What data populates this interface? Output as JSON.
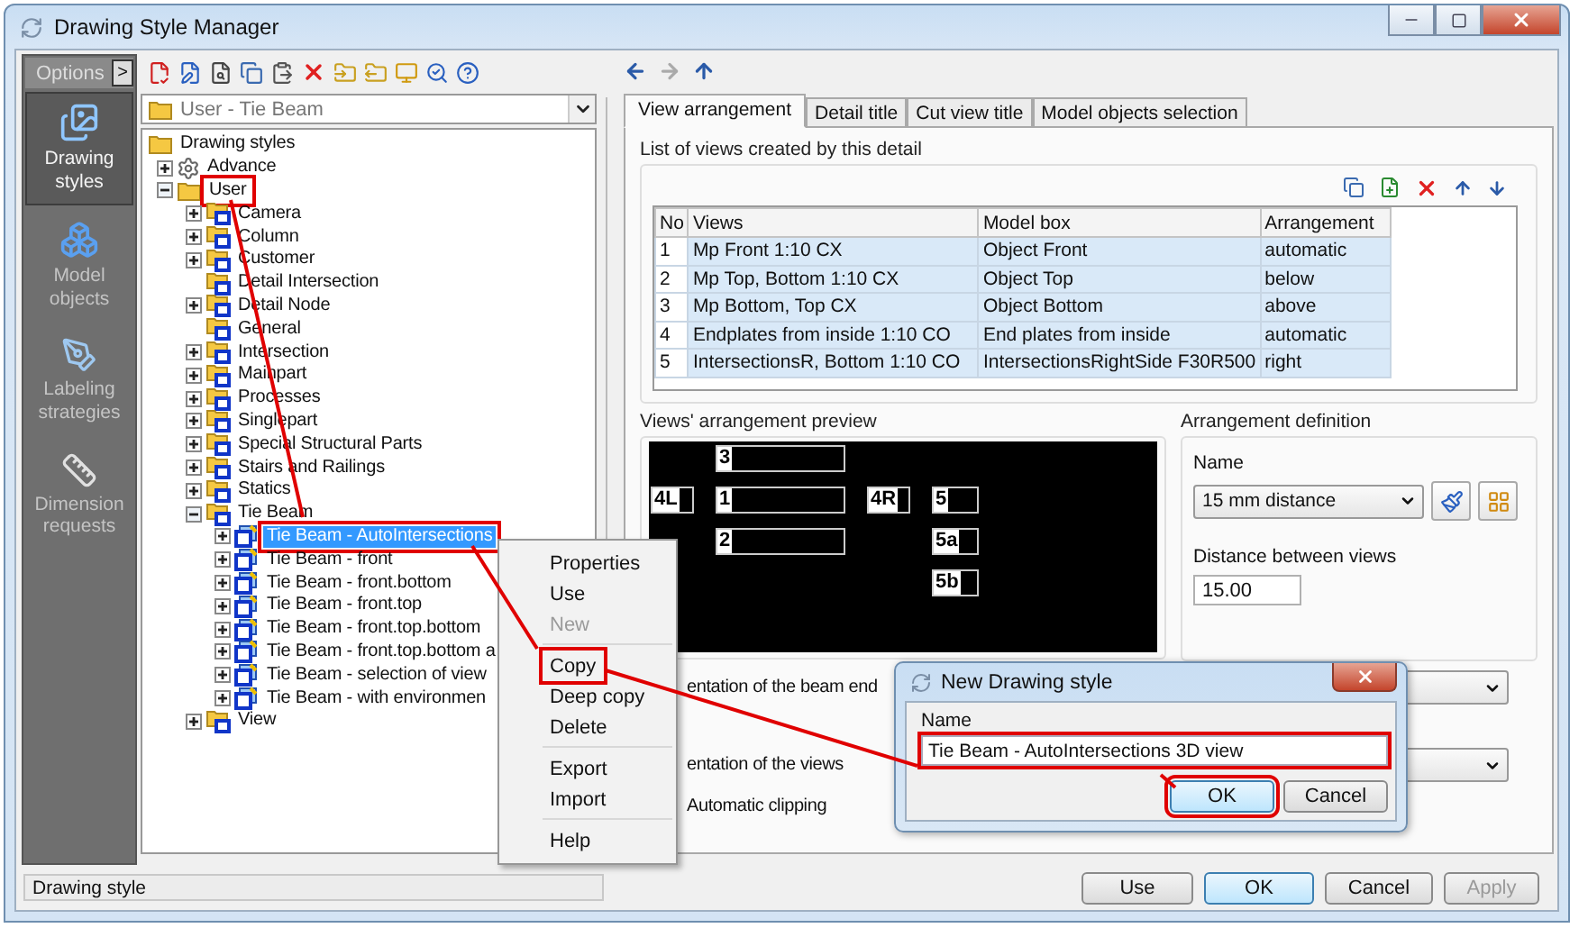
{
  "window": {
    "title": "Drawing Style Manager"
  },
  "sidebar": {
    "header": "Options",
    "expand_button": ">",
    "items": [
      {
        "label": "Drawing styles",
        "selected": true,
        "kind": "styles"
      },
      {
        "label": "Model objects",
        "selected": false,
        "kind": "objects"
      },
      {
        "label": "Labeling strategies",
        "selected": false,
        "kind": "labeling"
      },
      {
        "label": "Dimension requests",
        "selected": false,
        "kind": "dimension"
      }
    ]
  },
  "style_selector": {
    "value": "User - Tie Beam"
  },
  "tree": [
    {
      "label": "Drawing styles",
      "kind": "folder",
      "selected": false,
      "annotated": false,
      "children": [
        {
          "label": "Advance",
          "kind": "gear",
          "expanded": false,
          "selected": false,
          "annotated": false
        },
        {
          "label": "User",
          "kind": "folder",
          "expanded": true,
          "selected": false,
          "annotated": true,
          "children": [
            {
              "label": "Camera",
              "kind": "stylefolder",
              "expanded": false,
              "selected": false,
              "annotated": false
            },
            {
              "label": "Column",
              "kind": "stylefolder",
              "expanded": false,
              "selected": false,
              "annotated": false
            },
            {
              "label": "Customer",
              "kind": "stylefolder",
              "expanded": false,
              "selected": false,
              "annotated": false
            },
            {
              "label": "Detail Intersection",
              "kind": "stylefolder",
              "selected": false,
              "annotated": false
            },
            {
              "label": "Detail Node",
              "kind": "stylefolder",
              "expanded": false,
              "selected": false,
              "annotated": false
            },
            {
              "label": "General",
              "kind": "stylefolder",
              "selected": false,
              "annotated": false
            },
            {
              "label": "Intersection",
              "kind": "stylefolder",
              "expanded": false,
              "selected": false,
              "annotated": false
            },
            {
              "label": "Mainpart",
              "kind": "stylefolder",
              "expanded": false,
              "selected": false,
              "annotated": false
            },
            {
              "label": "Processes",
              "kind": "stylefolder",
              "expanded": false,
              "selected": false,
              "annotated": false
            },
            {
              "label": "Singlepart",
              "kind": "stylefolder",
              "expanded": false,
              "selected": false,
              "annotated": false
            },
            {
              "label": "Special Structural Parts",
              "kind": "stylefolder",
              "expanded": false,
              "selected": false,
              "annotated": false
            },
            {
              "label": "Stairs and Railings",
              "kind": "stylefolder",
              "expanded": false,
              "selected": false,
              "annotated": false
            },
            {
              "label": "Statics",
              "kind": "stylefolder",
              "expanded": false,
              "selected": false,
              "annotated": false
            },
            {
              "label": "Tie Beam",
              "kind": "stylefolder",
              "expanded": true,
              "selected": false,
              "annotated": false,
              "children": [
                {
                  "label": "Tie Beam - AutoIntersections",
                  "kind": "style",
                  "expanded": false,
                  "selected": true,
                  "annotated": true
                },
                {
                  "label": "Tie Beam - front",
                  "kind": "style",
                  "expanded": false,
                  "selected": false,
                  "annotated": false
                },
                {
                  "label": "Tie Beam - front.bottom",
                  "kind": "style",
                  "expanded": false,
                  "selected": false,
                  "annotated": false
                },
                {
                  "label": "Tie Beam - front.top",
                  "kind": "style",
                  "expanded": false,
                  "selected": false,
                  "annotated": false
                },
                {
                  "label": "Tie Beam - front.top.bottom",
                  "kind": "style",
                  "expanded": false,
                  "selected": false,
                  "annotated": false
                },
                {
                  "label": "Tie Beam - front.top.bottom a",
                  "kind": "style",
                  "expanded": false,
                  "selected": false,
                  "annotated": false
                },
                {
                  "label": "Tie Beam - selection of view",
                  "kind": "style",
                  "expanded": false,
                  "selected": false,
                  "annotated": false
                },
                {
                  "label": "Tie Beam - with environmen",
                  "kind": "style",
                  "expanded": false,
                  "selected": false,
                  "annotated": false
                }
              ]
            },
            {
              "label": "View",
              "kind": "stylefolder",
              "expanded": false,
              "selected": false,
              "annotated": false
            }
          ]
        }
      ]
    }
  ],
  "tabs": [
    {
      "label": "View arrangement",
      "selected": true
    },
    {
      "label": "Detail title",
      "selected": false
    },
    {
      "label": "Cut view title",
      "selected": false
    },
    {
      "label": "Model objects selection",
      "selected": false
    }
  ],
  "views_list": {
    "title": "List of views created by this detail",
    "columns": [
      "No",
      "Views",
      "Model box",
      "Arrangement"
    ],
    "rows": [
      [
        "1",
        "Mp Front 1:10 CX",
        "Object Front",
        "automatic"
      ],
      [
        "2",
        "Mp Top, Bottom 1:10 CX",
        "Object Top",
        "below"
      ],
      [
        "3",
        "Mp Bottom, Top CX",
        "Object Bottom",
        "above"
      ],
      [
        "4",
        "Endplates from inside 1:10 CO",
        "End plates from inside",
        "automatic"
      ],
      [
        "5",
        "IntersectionsR, Bottom 1:10 CO",
        "IntersectionsRightSide F30R500",
        "right"
      ]
    ]
  },
  "preview": {
    "title": "Views' arrangement preview",
    "left": [
      "4L"
    ],
    "main": [
      "3",
      "1",
      "2"
    ],
    "right": [
      "4R"
    ],
    "side": [
      "5",
      "5a",
      "5b"
    ]
  },
  "arrangement": {
    "title": "Arrangement definition",
    "name_label": "Name",
    "name_value": "15 mm distance",
    "distance_label": "Distance between views",
    "distance_value": "15.00"
  },
  "options": [
    {
      "label": "entation of the beam end",
      "kind": "dropdown"
    },
    {
      "label": "entation of the views",
      "kind": "dropdown"
    },
    {
      "label": "Automatic clipping",
      "kind": "plain"
    }
  ],
  "status": "Drawing style",
  "buttons": [
    {
      "label": "Use",
      "disabled": false,
      "default": false
    },
    {
      "label": "OK",
      "disabled": false,
      "default": true
    },
    {
      "label": "Cancel",
      "disabled": false,
      "default": false
    },
    {
      "label": "Apply",
      "disabled": true,
      "default": false
    }
  ],
  "context_menu": [
    {
      "kind": "item",
      "label": "Properties",
      "disabled": false,
      "annotated": false
    },
    {
      "kind": "item",
      "label": "Use",
      "disabled": false,
      "annotated": false
    },
    {
      "kind": "item",
      "label": "New",
      "disabled": true,
      "annotated": false
    },
    {
      "kind": "separator"
    },
    {
      "kind": "item",
      "label": "Copy",
      "disabled": false,
      "annotated": true
    },
    {
      "kind": "item",
      "label": "Deep copy",
      "disabled": false,
      "annotated": false
    },
    {
      "kind": "item",
      "label": "Delete",
      "disabled": false,
      "annotated": false
    },
    {
      "kind": "separator"
    },
    {
      "kind": "item",
      "label": "Export",
      "disabled": false,
      "annotated": false
    },
    {
      "kind": "item",
      "label": "Import",
      "disabled": false,
      "annotated": false
    },
    {
      "kind": "separator"
    },
    {
      "kind": "item",
      "label": "Help",
      "disabled": false,
      "annotated": false
    }
  ],
  "dialog": {
    "title": "New Drawing style",
    "field_label": "Name",
    "value": "Tie Beam - AutoIntersections 3D view",
    "annotated": true,
    "buttons": [
      {
        "label": "OK",
        "default": true,
        "annotated": true
      },
      {
        "label": "Cancel",
        "default": false,
        "annotated": false
      }
    ]
  }
}
